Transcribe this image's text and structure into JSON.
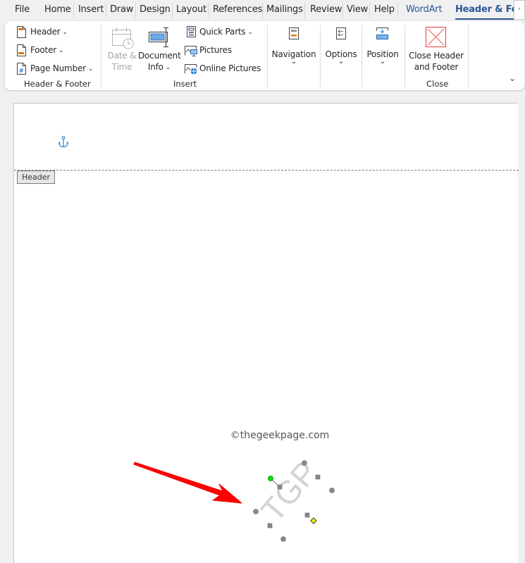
{
  "tabs": [
    {
      "label": "File"
    },
    {
      "label": "Home"
    },
    {
      "label": "Insert"
    },
    {
      "label": "Draw"
    },
    {
      "label": "Design"
    },
    {
      "label": "Layout"
    },
    {
      "label": "References"
    },
    {
      "label": "Mailings"
    },
    {
      "label": "Review"
    },
    {
      "label": "View"
    },
    {
      "label": "Help"
    },
    {
      "label": "WordArt"
    },
    {
      "label": "Header & Foo"
    }
  ],
  "active_tab": "Header & Footer",
  "tab_scroll_glyph": "›",
  "ribbon": {
    "header_footer_group": {
      "header": "Header",
      "footer": "Footer",
      "page_number": "Page Number",
      "label": "Header & Footer"
    },
    "insert_group": {
      "date_time_line1": "Date &",
      "date_time_line2": "Time",
      "document_info_line1": "Document",
      "document_info_line2": "Info",
      "quick_parts": "Quick Parts",
      "pictures": "Pictures",
      "online_pictures": "Online Pictures",
      "label": "Insert"
    },
    "navigation": "Navigation",
    "options": "Options",
    "position": "Position",
    "close_group": {
      "close_line1": "Close Header",
      "close_line2": "and Footer",
      "label": "Close"
    },
    "chevron_glyph": "⌄",
    "collapse_glyph": "⌄"
  },
  "document": {
    "header_tag": "Header",
    "watermark_credit": "©thegeekpage.com",
    "wordart_text": "TGP"
  },
  "colors": {
    "accent": "#2b579a",
    "annotation_arrow": "#ff0000",
    "rotate_handle": "#00dd00",
    "adjust_handle": "#ffff00",
    "anchor": "#2e8bd0"
  }
}
